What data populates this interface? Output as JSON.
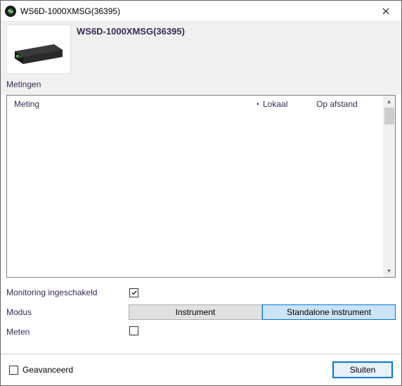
{
  "window": {
    "title": "WS6D-1000XMSG(36395)"
  },
  "header": {
    "device_title": "WS6D-1000XMSG(36395)",
    "section_label": "Metingen"
  },
  "grid": {
    "columns": {
      "meting": "Meting",
      "sep": "▪",
      "lokaal": "Lokaal",
      "opafstand": "Op afstand"
    }
  },
  "form": {
    "monitoring_label": "Monitoring ingeschakeld",
    "monitoring_checked": true,
    "modus_label": "Modus",
    "modus_options": {
      "instrument": "Instrument",
      "standalone": "Standalone instrument"
    },
    "modus_selected": "standalone",
    "meten_label": "Meten",
    "meten_checked": false
  },
  "footer": {
    "advanced_label": "Geavanceerd",
    "advanced_checked": false,
    "close_label": "Sluiten"
  }
}
